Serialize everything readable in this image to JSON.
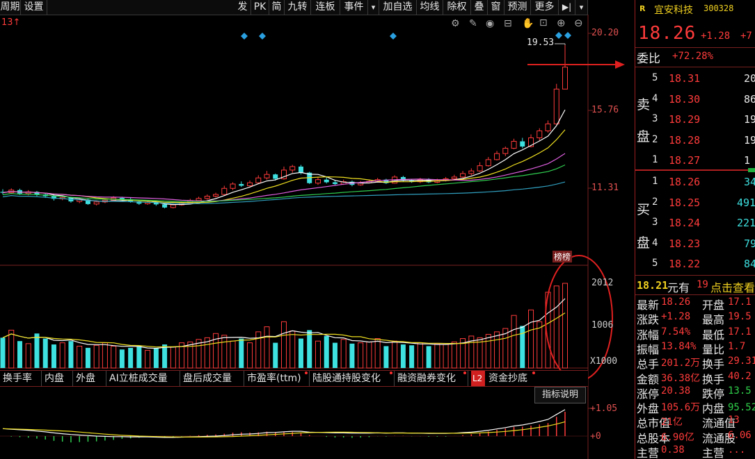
{
  "toolbar": {
    "items": [
      "周期",
      "设置",
      "发",
      "PK",
      "简",
      "九转",
      "连板",
      "事件",
      "▾",
      "加自选",
      "均线",
      "除权",
      "叠",
      "窗",
      "预测",
      "更多",
      "▶|",
      "▾"
    ]
  },
  "chart": {
    "period_indicator": "13↑",
    "y_axis_top": "20.20",
    "y_axis_mid": "15.76",
    "y_axis_low": "11.31",
    "high_label": "19.53",
    "board_badge": "榜榜",
    "volume_axis_top": "2012",
    "volume_axis_mid": "1006",
    "volume_unit": "X1000",
    "indicator_axis_top": "+1.05",
    "indicator_axis_zero": "+0",
    "indicator_help": "指标说明",
    "tool_icons": [
      "gear-icon",
      "pen-icon",
      "eye-icon",
      "lock-icon",
      "hand-icon",
      "zoom-in-icon",
      "zoom-out-icon"
    ]
  },
  "bottom_tabs": [
    "换手率",
    "内盘",
    "外盘",
    "AI立桩成交量",
    "盘后成交量",
    "市盈率(ttm)",
    "陆股通持股变化",
    "融资融券变化",
    "L2",
    "资金抄底"
  ],
  "quote": {
    "r_tag": "R",
    "name": "宜安科技",
    "code": "300328",
    "price": "18.26",
    "change": "+1.28",
    "change_pct_trunc": "+7",
    "weibi_label": "委比",
    "weibi_value": "+72.28%",
    "sell_label_1": "卖",
    "sell_label_2": "盘",
    "buy_label_1": "买",
    "buy_label_2": "盘",
    "sell": [
      {
        "level": "5",
        "price": "18.31",
        "vol": "20"
      },
      {
        "level": "4",
        "price": "18.30",
        "vol": "86"
      },
      {
        "level": "3",
        "price": "18.29",
        "vol": "19"
      },
      {
        "level": "2",
        "price": "18.28",
        "vol": "19"
      },
      {
        "level": "1",
        "price": "18.27",
        "vol": "1"
      }
    ],
    "buy": [
      {
        "level": "1",
        "price": "18.26",
        "vol": "34"
      },
      {
        "level": "2",
        "price": "18.25",
        "vol": "491"
      },
      {
        "level": "3",
        "price": "18.24",
        "vol": "221"
      },
      {
        "level": "4",
        "price": "18.23",
        "vol": "79"
      },
      {
        "level": "5",
        "price": "18.22",
        "vol": "84"
      }
    ],
    "banner_price": "18.21",
    "banner_text1": "元有",
    "banner_text2": "19",
    "banner_text3": "点击查看",
    "stats": [
      {
        "l1": "最新",
        "v1": "18.26",
        "l2": "开盘",
        "v2": "17.1"
      },
      {
        "l1": "涨跌",
        "v1": "+1.28",
        "l2": "最高",
        "v2": "19.5"
      },
      {
        "l1": "涨幅",
        "v1": "7.54%",
        "l2": "最低",
        "v2": "17.1"
      },
      {
        "l1": "振幅",
        "v1": "13.84%",
        "l2": "量比",
        "v2": "1.7"
      },
      {
        "l1": "总手",
        "v1": "201.2万",
        "l2": "换手",
        "v2": "29.31"
      },
      {
        "l1": "金额",
        "v1": "36.38亿",
        "l2": "换手",
        "v2": "40.2"
      },
      {
        "l1": "涨停",
        "v1": "20.38",
        "l2": "跌停",
        "v2": "13.5"
      },
      {
        "l1": "外盘",
        "v1": "105.6万",
        "l2": "内盘",
        "v2": "95.52万"
      },
      {
        "l1": "总市值",
        "v1": "21亿",
        "l2": "流通值",
        "v2": "13"
      },
      {
        "l1": "总股本",
        "v1": "6.90亿",
        "l2": "流通股",
        "v2": "6.06"
      },
      {
        "l1": "主营",
        "v1": "0.38",
        "l2": "主营",
        "v2": "..."
      }
    ]
  },
  "colors": {
    "up": "#ff3b3b",
    "down": "#3ee0e0",
    "axis_red": "#7a1f1f",
    "ma_white": "#ffffff",
    "ma_yellow": "#f0e020",
    "ma_purple": "#e060e0",
    "ma_green": "#30d050",
    "ma_teal": "#30a0c0"
  }
}
